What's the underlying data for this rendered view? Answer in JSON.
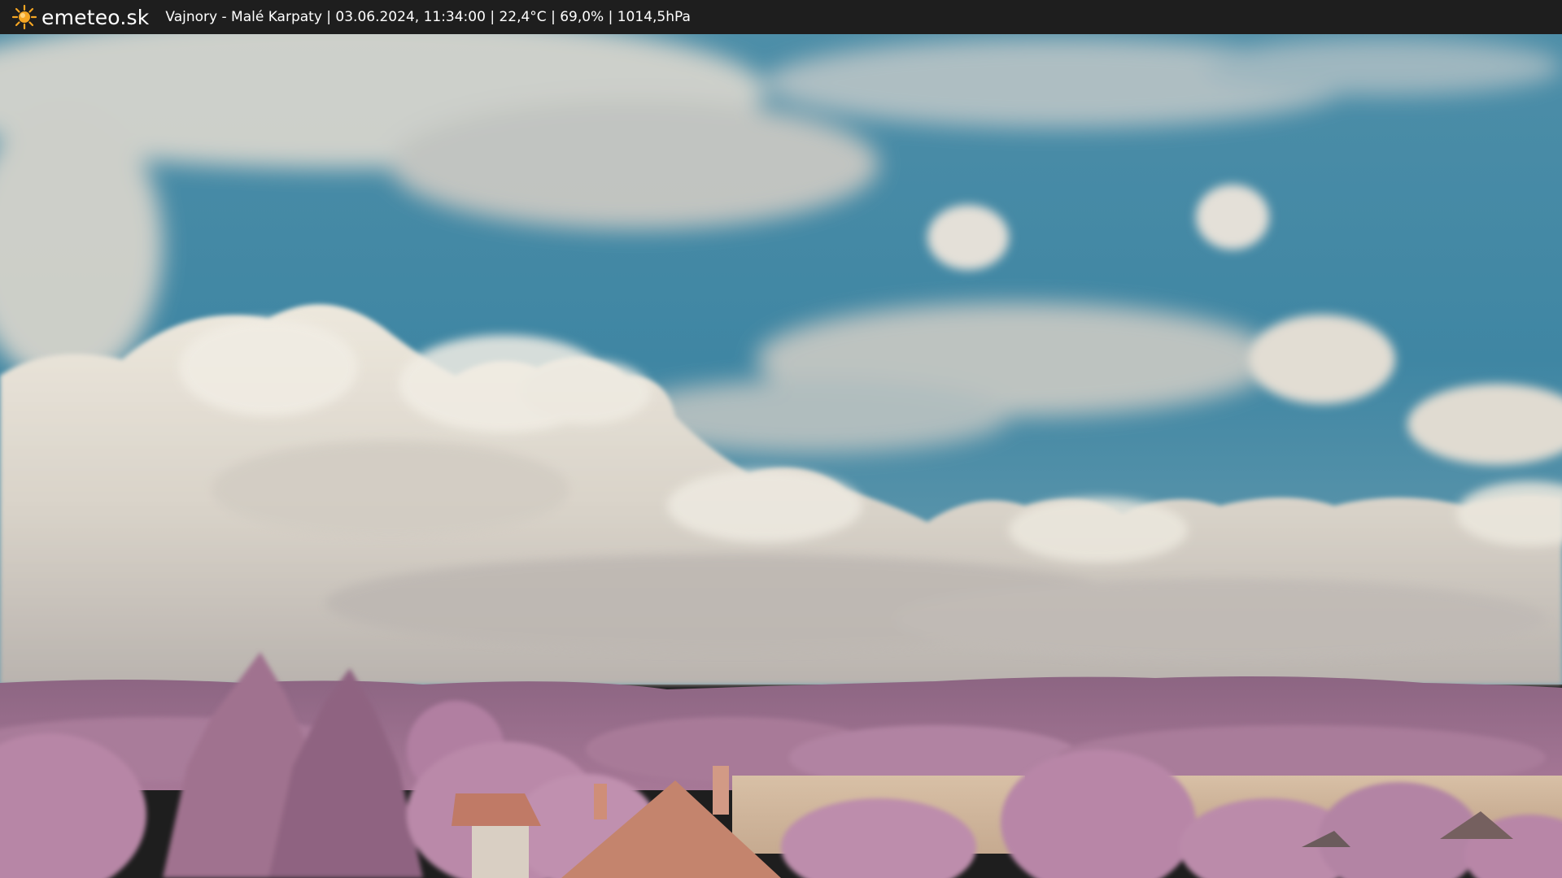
{
  "header": {
    "brand": "emeteo.sk",
    "brand_icon": "sun-icon",
    "status": "Vajnory - Malé Karpaty | 03.06.2024, 11:34:00 | 22,4°C | 69,0% | 1014,5hPa"
  },
  "colors": {
    "bar": "#1e1e1e",
    "sun": "#f5a623",
    "sky": "#3f8aa6",
    "cloud": "#ece7dc",
    "hills": "#9a6a8c",
    "foliage": "#b07fa2",
    "field": "#cdb399",
    "roof": "#c2826a"
  }
}
